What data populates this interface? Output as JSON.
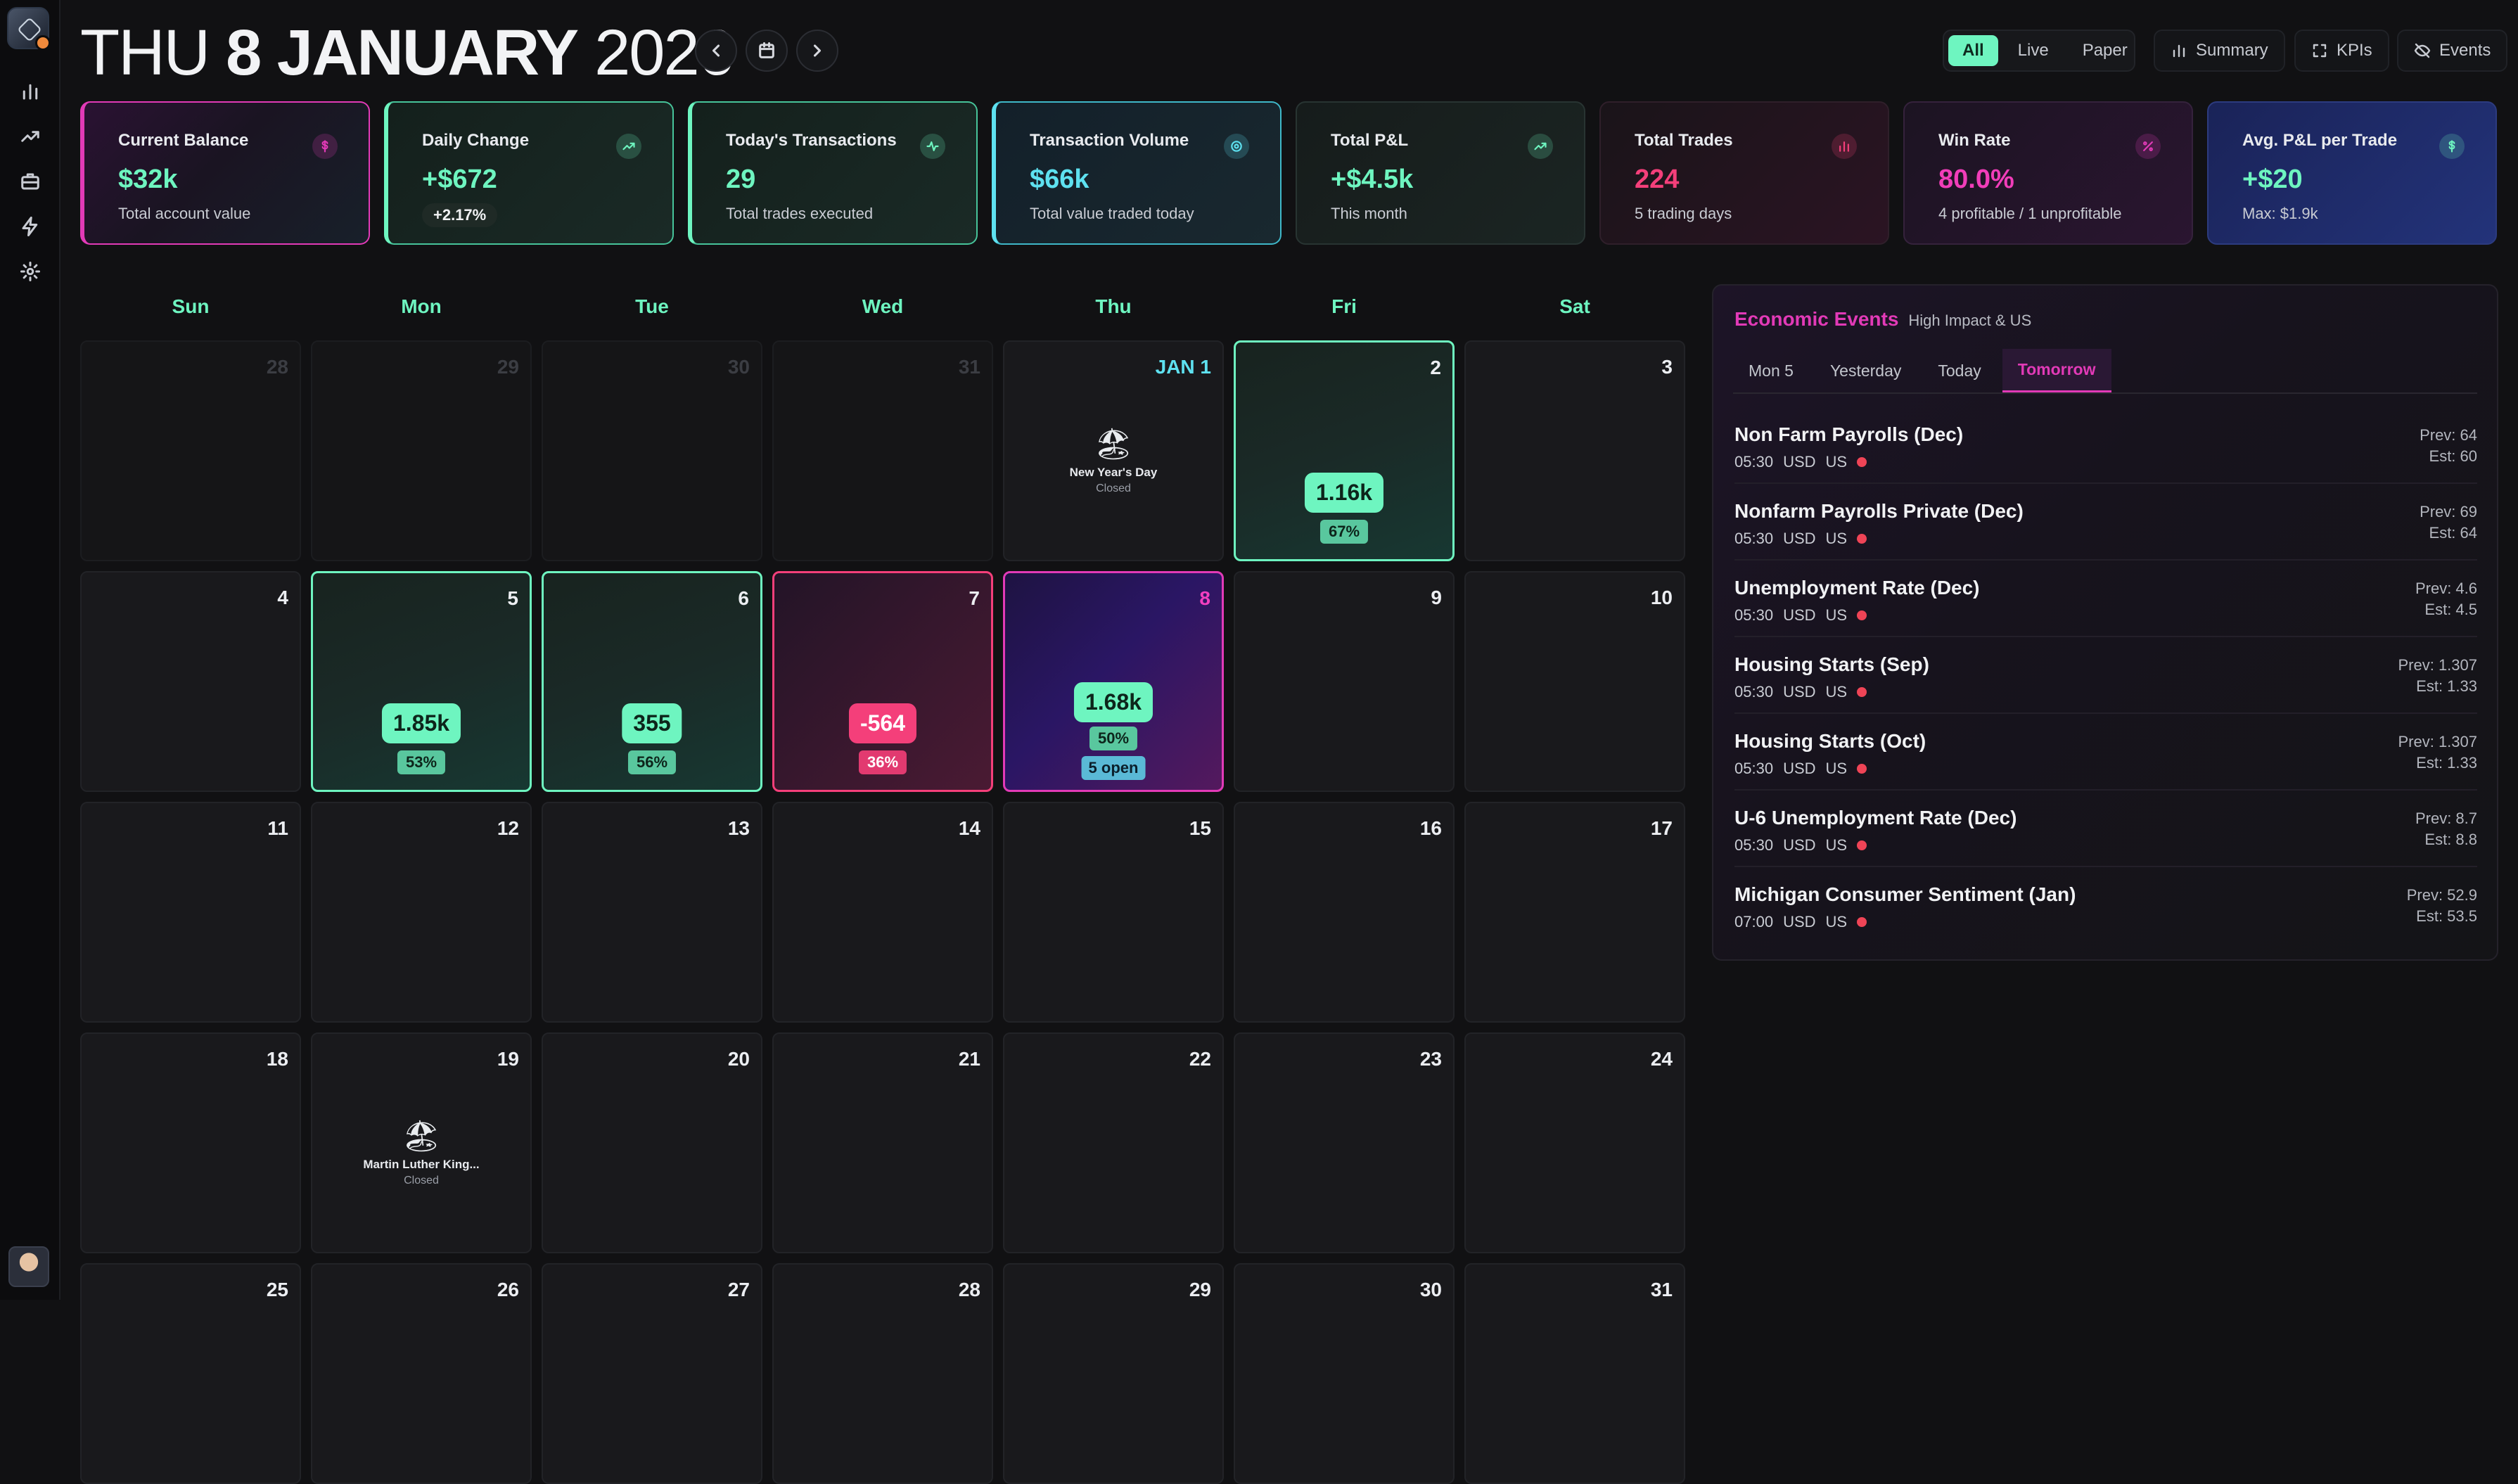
{
  "header": {
    "dow": "THU",
    "daymonth": "8 JANUARY",
    "year": "2026",
    "view_options": [
      "All",
      "Live",
      "Paper"
    ],
    "active_view": "All",
    "summary_label": "Summary",
    "kpis_label": "KPIs",
    "events_label": "Events"
  },
  "kpis": [
    {
      "title": "Current Balance",
      "value": "$32k",
      "sub": "Total account value",
      "icon": "dollar-icon",
      "accent": "#e23ab7"
    },
    {
      "title": "Daily Change",
      "value": "+$672",
      "badge": "+2.17%",
      "icon": "trend-up-icon",
      "accent": "#6ef5c0"
    },
    {
      "title": "Today's Transactions",
      "value": "29",
      "sub": "Total trades executed",
      "icon": "pulse-icon",
      "accent": "#6ef5c0"
    },
    {
      "title": "Transaction Volume",
      "value": "$66k",
      "sub": "Total value traded today",
      "icon": "target-icon",
      "accent": "#5ee1f0"
    },
    {
      "title": "Total P&L",
      "value": "+$4.5k",
      "sub": "This month",
      "icon": "trend-up-icon",
      "accent": "#6ef5c0"
    },
    {
      "title": "Total Trades",
      "value": "224",
      "sub": "5 trading days",
      "icon": "bar-chart-icon",
      "accent": "#f43f7a"
    },
    {
      "title": "Win Rate",
      "value": "80.0%",
      "sub": "4 profitable / 1 unprofitable",
      "icon": "percent-icon",
      "accent": "#e23ab7"
    },
    {
      "title": "Avg. P&L per Trade",
      "value": "+$20",
      "sub": "Max: $1.9k",
      "icon": "dollar-icon",
      "accent": "#6ef5c0"
    }
  ],
  "calendar": {
    "weekdays": [
      "Sun",
      "Mon",
      "Tue",
      "Wed",
      "Thu",
      "Fri",
      "Sat"
    ],
    "weeks": [
      [
        {
          "day": "28",
          "kind": "prev"
        },
        {
          "day": "29",
          "kind": "prev"
        },
        {
          "day": "30",
          "kind": "prev"
        },
        {
          "day": "31",
          "kind": "prev"
        },
        {
          "day": "JAN 1",
          "kind": "holiday",
          "holiday": "New Year's Day",
          "status": "Closed"
        },
        {
          "day": "2",
          "kind": "green",
          "pnl": "1.16k",
          "pct": "67%"
        },
        {
          "day": "3",
          "kind": "plain"
        }
      ],
      [
        {
          "day": "4",
          "kind": "plain"
        },
        {
          "day": "5",
          "kind": "green",
          "pnl": "1.85k",
          "pct": "53%"
        },
        {
          "day": "6",
          "kind": "green",
          "pnl": "355",
          "pct": "56%"
        },
        {
          "day": "7",
          "kind": "red",
          "pnl": "-564",
          "pct": "36%"
        },
        {
          "day": "8",
          "kind": "today",
          "pnl": "1.68k",
          "pct": "50%",
          "open": "5 open"
        },
        {
          "day": "9",
          "kind": "plain"
        },
        {
          "day": "10",
          "kind": "plain"
        }
      ],
      [
        {
          "day": "11",
          "kind": "plain"
        },
        {
          "day": "12",
          "kind": "plain"
        },
        {
          "day": "13",
          "kind": "plain"
        },
        {
          "day": "14",
          "kind": "plain"
        },
        {
          "day": "15",
          "kind": "plain"
        },
        {
          "day": "16",
          "kind": "plain"
        },
        {
          "day": "17",
          "kind": "plain"
        }
      ],
      [
        {
          "day": "18",
          "kind": "plain"
        },
        {
          "day": "19",
          "kind": "holiday",
          "holiday": "Martin Luther King...",
          "status": "Closed"
        },
        {
          "day": "20",
          "kind": "plain"
        },
        {
          "day": "21",
          "kind": "plain"
        },
        {
          "day": "22",
          "kind": "plain"
        },
        {
          "day": "23",
          "kind": "plain"
        },
        {
          "day": "24",
          "kind": "plain"
        }
      ],
      [
        {
          "day": "25",
          "kind": "plain"
        },
        {
          "day": "26",
          "kind": "plain"
        },
        {
          "day": "27",
          "kind": "plain"
        },
        {
          "day": "28",
          "kind": "plain"
        },
        {
          "day": "29",
          "kind": "plain"
        },
        {
          "day": "30",
          "kind": "plain"
        },
        {
          "day": "31",
          "kind": "plain"
        }
      ]
    ]
  },
  "events": {
    "title": "Economic Events",
    "subtitle": "High Impact & US",
    "tabs": [
      "Mon 5",
      "Yesterday",
      "Today",
      "Tomorrow"
    ],
    "active_tab": "Tomorrow",
    "items": [
      {
        "name": "Non Farm Payrolls (Dec)",
        "time": "05:30",
        "currency": "USD",
        "country": "US",
        "prev": "Prev: 64",
        "est": "Est: 60"
      },
      {
        "name": "Nonfarm Payrolls Private (Dec)",
        "time": "05:30",
        "currency": "USD",
        "country": "US",
        "prev": "Prev: 69",
        "est": "Est: 64"
      },
      {
        "name": "Unemployment Rate (Dec)",
        "time": "05:30",
        "currency": "USD",
        "country": "US",
        "prev": "Prev: 4.6",
        "est": "Est: 4.5"
      },
      {
        "name": "Housing Starts (Sep)",
        "time": "05:30",
        "currency": "USD",
        "country": "US",
        "prev": "Prev: 1.307",
        "est": "Est: 1.33"
      },
      {
        "name": "Housing Starts (Oct)",
        "time": "05:30",
        "currency": "USD",
        "country": "US",
        "prev": "Prev: 1.307",
        "est": "Est: 1.33"
      },
      {
        "name": "U-6 Unemployment Rate (Dec)",
        "time": "05:30",
        "currency": "USD",
        "country": "US",
        "prev": "Prev: 8.7",
        "est": "Est: 8.8"
      },
      {
        "name": "Michigan Consumer Sentiment (Jan)",
        "time": "07:00",
        "currency": "USD",
        "country": "US",
        "prev": "Prev: 52.9",
        "est": "Est: 53.5"
      }
    ]
  },
  "sidebar": {
    "icons": [
      "bar-chart-icon",
      "trend-up-icon",
      "briefcase-icon",
      "lightning-icon",
      "gear-icon"
    ]
  }
}
